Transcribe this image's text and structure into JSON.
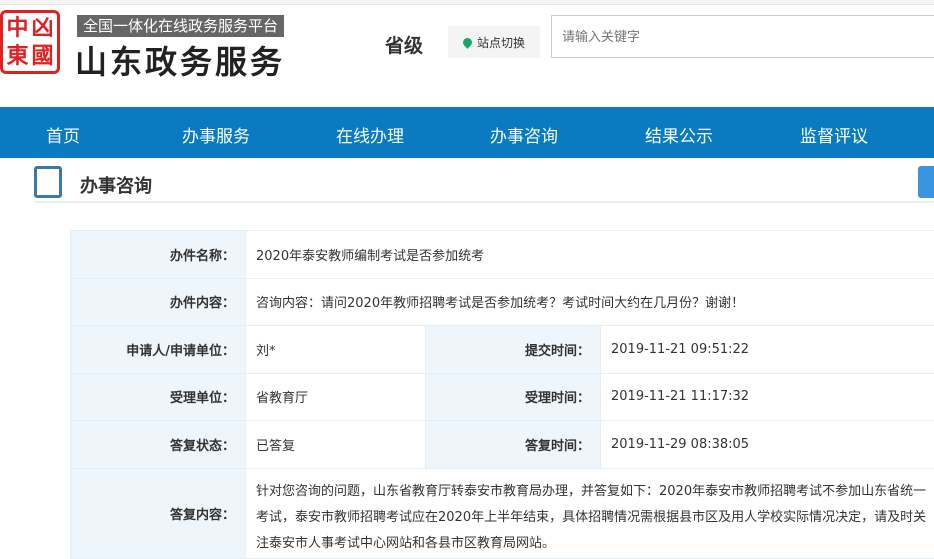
{
  "header": {
    "seal_text": [
      "中",
      "凶",
      "國",
      "東"
    ],
    "subtitle": "全国一体化在线政务服务平台",
    "title": "山东政务服务",
    "level": "省级",
    "switch_label": "站点切换",
    "search_placeholder": "请输入关键字"
  },
  "nav": [
    "首页",
    "办事服务",
    "在线办理",
    "办事咨询",
    "结果公示",
    "监督评议"
  ],
  "section_title": "办事咨询",
  "detail": {
    "name_label": "办件名称：",
    "name": "2020年泰安教师编制考试是否参加统考",
    "content_label": "办件内容：",
    "content": "咨询内容：请问2020年教师招聘考试是否参加统考？考试时间大约在几月份？谢谢！",
    "applicant_label": "申请人/申请单位：",
    "applicant": "刘*",
    "submit_label": "提交时间：",
    "submit_time": "2019-11-21 09:51:22",
    "dept_label": "受理单位：",
    "dept": "省教育厅",
    "accept_label": "受理时间：",
    "accept_time": "2019-11-21 11:17:32",
    "status_label": "答复状态：",
    "status": "已答复",
    "reply_time_label": "答复时间：",
    "reply_time": "2019-11-29 08:38:05",
    "reply_label": "答复内容：",
    "reply": "针对您咨询的问题，山东省教育厅转泰安市教育局办理，并答复如下：2020年泰安市教师招聘考试不参加山东省统一考试，泰安市教师招聘考试应在2020年上半年结束，具体招聘情况需根据县市区及用人学校实际情况决定，请及时关注泰安市人事考试中心网站和各县市区教育局网站。"
  }
}
